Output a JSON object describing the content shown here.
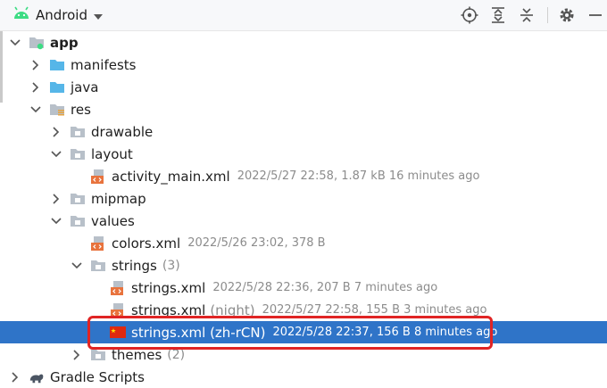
{
  "toolbar": {
    "view_label": "Android",
    "icons": [
      "locate-icon",
      "expand-all-icon",
      "collapse-all-icon",
      "settings-icon",
      "hide-icon"
    ]
  },
  "tree": {
    "app": {
      "label": "app"
    },
    "manifests": {
      "label": "manifests"
    },
    "java": {
      "label": "java"
    },
    "res": {
      "label": "res"
    },
    "drawable": {
      "label": "drawable"
    },
    "layout": {
      "label": "layout"
    },
    "activity_main": {
      "label": "activity_main.xml",
      "meta": "2022/5/27 22:58, 1.87 kB 16 minutes ago"
    },
    "mipmap": {
      "label": "mipmap"
    },
    "values": {
      "label": "values"
    },
    "colors": {
      "label": "colors.xml",
      "meta": "2022/5/26 23:02, 378 B"
    },
    "strings_group": {
      "label": "strings",
      "count": "(3)"
    },
    "strings_default": {
      "label": "strings.xml",
      "meta": "2022/5/28 22:36, 207 B 7 minutes ago"
    },
    "strings_night": {
      "label": "strings.xml",
      "qualifier": "(night)",
      "meta": "2022/5/27 22:58, 155 B 3 minutes ago"
    },
    "strings_zh": {
      "label": "strings.xml (zh-rCN)",
      "meta": "2022/5/28 22:37, 156 B 8 minutes ago"
    },
    "themes": {
      "label": "themes",
      "count": "(2)"
    },
    "gradle": {
      "label": "Gradle Scripts"
    }
  },
  "colors": {
    "selection": "#2f74c8",
    "highlight_box": "#e02424",
    "folder": "#56b6e8"
  }
}
